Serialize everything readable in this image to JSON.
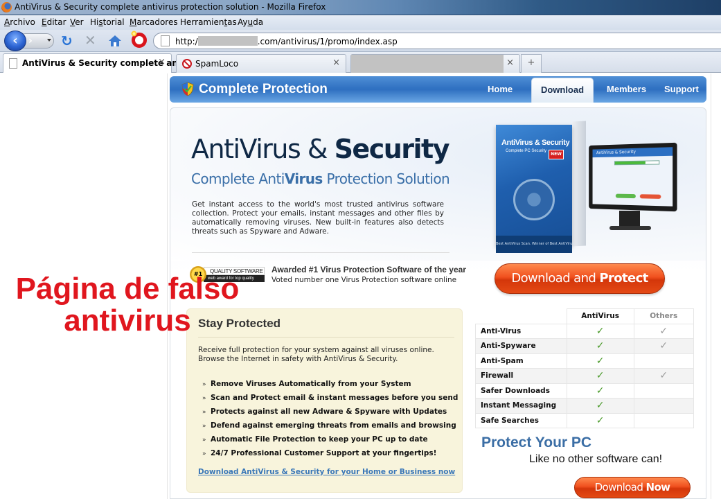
{
  "browser": {
    "window_title": "AntiVirus & Security complete antivirus protection solution - Mozilla Firefox",
    "menu": [
      {
        "label": "Archivo",
        "mnemonic": "A"
      },
      {
        "label": "Editar",
        "mnemonic": "E"
      },
      {
        "label": "Ver",
        "mnemonic": "V"
      },
      {
        "label": "Historial",
        "mnemonic": "s"
      },
      {
        "label": "Marcadores",
        "mnemonic": "M"
      },
      {
        "label": "Herramientas",
        "mnemonic": "t"
      },
      {
        "label": "Ayuda",
        "mnemonic": "u"
      }
    ],
    "url_prefix": "http:/",
    "url_suffix": ".com/antivirus/1/promo/index.asp",
    "tabs": [
      {
        "label": "AntiVirus & Security complete an...",
        "active": true,
        "icon": "page-icon"
      },
      {
        "label": "SpamLoco",
        "active": false,
        "icon": "no-spam-icon"
      },
      {
        "label": "",
        "active": false,
        "redacted": true
      }
    ],
    "tab_close_glyph": "×",
    "new_tab_glyph": "+"
  },
  "site": {
    "brand": "Complete Protection",
    "nav": [
      {
        "label": "Home",
        "active": false
      },
      {
        "label": "Download",
        "active": true
      },
      {
        "label": "Members",
        "active": false
      },
      {
        "label": "Support",
        "active": false
      }
    ],
    "hero": {
      "title_light": "AntiVirus & ",
      "title_bold": "Security",
      "subtitle_pre": "Complete Anti",
      "subtitle_bold": "Virus",
      "subtitle_post": " Protection Solution",
      "description": "Get instant access to the world's most trusted antivirus software collection. Protect your emails, instant messages and other files by automatically removing viruses. New built-in features also detects threats such as Spyware and Adware."
    },
    "product": {
      "box_title": "AntiVirus & Security",
      "box_subtitle": "Complete PC Security",
      "box_badge": "NEW",
      "box_footer": "Best AntiVirus Scan. Winner of Best AntiVirus.",
      "screen_title": "AntiVirus & Security",
      "scan_progress": 0.7
    },
    "award": {
      "medal": "#1",
      "badge_top": "QUALITY SOFTWARE",
      "badge_bottom": "web award for top quality",
      "title": "Awarded #1 Virus Protection Software of the year",
      "subtitle": "Voted number one Virus Protection software online"
    },
    "cta_main": {
      "light": "Download and ",
      "bold": "Protect"
    },
    "stay": {
      "title": "Stay Protected",
      "description": "Receive full protection for your system against all viruses online. Browse the Internet in safety with AntiVirus & Security.",
      "bullet_glyph": "»",
      "features": [
        "Remove Viruses Automatically from your System",
        "Scan and Protect email & instant messages before you send",
        "Protects against all new Adware & Spyware with Updates",
        "Defend against emerging threats from emails and browsing",
        "Automatic File Protection to keep your PC up to date",
        "24/7 Professional Customer Support at your fingertips!"
      ],
      "link": "Download AntiVirus & Security for your Home or Business now"
    },
    "comparison": {
      "columns": [
        "AntiVirus",
        "Others"
      ],
      "check_glyph": "✓",
      "rows": [
        {
          "feature": "Anti-Virus",
          "antivirus": true,
          "others": true
        },
        {
          "feature": "Anti-Spyware",
          "antivirus": true,
          "others": true
        },
        {
          "feature": "Anti-Spam",
          "antivirus": true,
          "others": false
        },
        {
          "feature": "Firewall",
          "antivirus": true,
          "others": true
        },
        {
          "feature": "Safer Downloads",
          "antivirus": true,
          "others": false
        },
        {
          "feature": "Instant Messaging",
          "antivirus": true,
          "others": false
        },
        {
          "feature": "Safe Searches",
          "antivirus": true,
          "others": false
        }
      ]
    },
    "protect": {
      "title": "Protect Your PC",
      "subtitle": "Like no other software can!",
      "cta": {
        "light": "Download ",
        "bold": "Now"
      }
    }
  },
  "annotation": {
    "line1": "Página de falso",
    "line2": "antivirus",
    "color": "#e0161e"
  },
  "colors": {
    "header_blue": "#2e6fc0",
    "cta_orange": "#f0501e",
    "check_green": "#4a9a2a",
    "check_gray": "#9a9a9a",
    "stay_bg": "#f8f4dc",
    "link_blue": "#3a77b8"
  }
}
